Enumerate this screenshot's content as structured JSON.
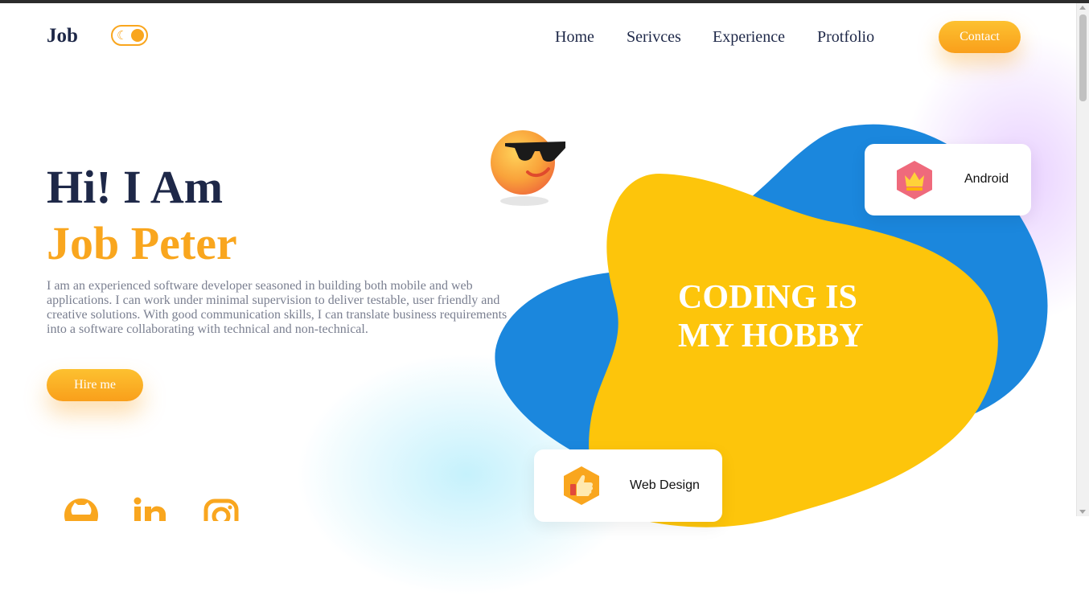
{
  "header": {
    "logo": "Job",
    "theme_toggle": {
      "icon": "moon-icon",
      "state": "on"
    },
    "nav": [
      "Home",
      "Serivces",
      "Experience",
      "Protfolio"
    ],
    "contact_label": "Contact"
  },
  "hero": {
    "greeting": "Hi! I Am",
    "name": "Job Peter",
    "bio": "I am an experienced software developer seasoned in building both mobile and web applications. I can work under minimal supervision to deliver testable, user friendly and creative solutions. With good communication skills, I can translate business requirements into a software collaborating with technical and non-technical.",
    "hire_label": "Hire me"
  },
  "social": [
    "github-icon",
    "linkedin-icon",
    "instagram-icon"
  ],
  "showcase": {
    "hobby_line1": "CODING IS",
    "hobby_line2": "MY HOBBY",
    "cards": [
      {
        "label": "Android",
        "icon": "crown-icon"
      },
      {
        "label": "Web Design",
        "icon": "thumbs-up-icon"
      }
    ]
  },
  "colors": {
    "accent": "#f9a61e",
    "navy": "#1e2848",
    "blob_blue": "#1b87dd",
    "blob_yellow": "#fdc50b"
  }
}
